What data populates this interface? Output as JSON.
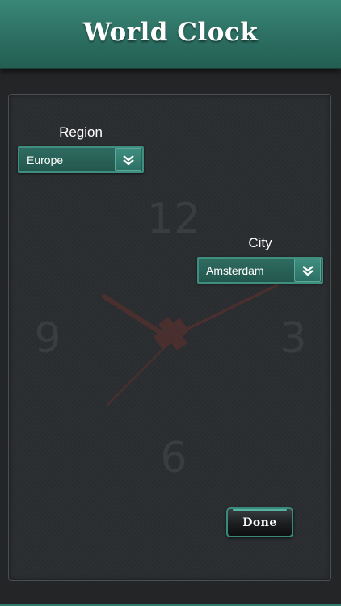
{
  "header": {
    "title": "World Clock"
  },
  "clock": {
    "numerals": [
      "12",
      "3",
      "6",
      "9"
    ],
    "hand_color": "#4a2f2f"
  },
  "region": {
    "label": "Region",
    "value": "Europe",
    "icon": "chevron-down-double-icon"
  },
  "city": {
    "label": "City",
    "value": "Amsterdam",
    "icon": "chevron-down-double-icon"
  },
  "actions": {
    "done_label": "Done"
  },
  "colors": {
    "accent": "#2f7a6c",
    "background": "#232527"
  }
}
